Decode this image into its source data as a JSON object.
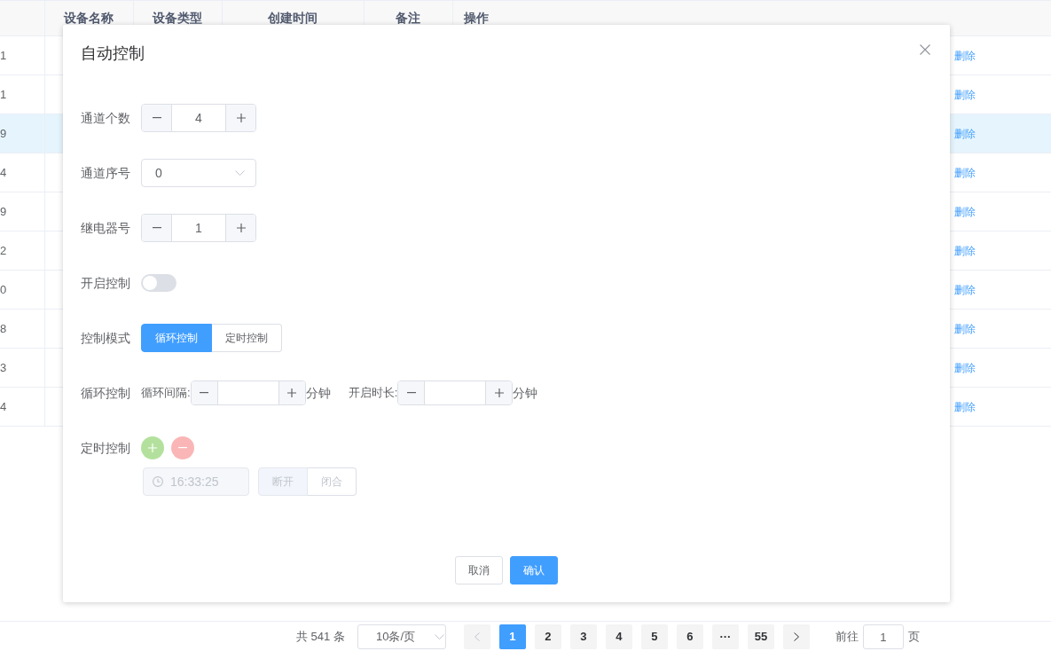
{
  "table": {
    "columns": [
      "设备名称",
      "设备类型",
      "创建时间",
      "备注",
      "操作"
    ],
    "rows": [
      {
        "column_1": "1",
        "selected": false,
        "action": "删除"
      },
      {
        "column_1": "1",
        "selected": false,
        "action": "删除"
      },
      {
        "column_1": "9",
        "selected": true,
        "action": "删除"
      },
      {
        "column_1": "4",
        "selected": false,
        "action": "删除"
      },
      {
        "column_1": "9",
        "selected": false,
        "action": "删除"
      },
      {
        "column_1": "2",
        "selected": false,
        "action": "删除"
      },
      {
        "column_1": "0",
        "selected": false,
        "action": "删除"
      },
      {
        "column_1": "8",
        "selected": false,
        "action": "删除"
      },
      {
        "column_1": "3",
        "selected": false,
        "action": "删除"
      },
      {
        "column_1": "4",
        "selected": false,
        "action": "删除"
      }
    ]
  },
  "dialog": {
    "title": "自动控制",
    "fields": [
      {
        "kind": "number",
        "label": "通道个数",
        "value": "4"
      },
      {
        "kind": "select",
        "label": "通道序号",
        "value": "0"
      },
      {
        "kind": "number",
        "label": "继电器号",
        "value": "1"
      },
      {
        "kind": "switch",
        "label": "开启控制",
        "on": false
      },
      {
        "kind": "radio",
        "label": "控制模式",
        "options": [
          {
            "label": "循环控制",
            "selected": true
          },
          {
            "label": "定时控制",
            "selected": false
          }
        ]
      },
      {
        "kind": "cycle",
        "label": "循环控制",
        "inputs": [
          {
            "label": "循环间隔:",
            "unit": "分钟"
          },
          {
            "label": "开启时长:",
            "unit": "分钟"
          }
        ]
      },
      {
        "kind": "timer",
        "label": "定时控制",
        "entries": [
          {
            "time": "16:33:25",
            "disabled": true,
            "options": [
              {
                "label": "断开",
                "selected": true
              },
              {
                "label": "闭合",
                "selected": false
              }
            ]
          }
        ]
      }
    ],
    "buttons": [
      {
        "label": "取消",
        "primary": false
      },
      {
        "label": "确认",
        "primary": true
      }
    ]
  },
  "pagination": {
    "total": "共 541 条",
    "page_size": "10条/页",
    "pages": [
      {
        "label": "1",
        "selected": true
      },
      {
        "label": "2",
        "selected": false
      },
      {
        "label": "3",
        "selected": false
      },
      {
        "label": "4",
        "selected": false
      },
      {
        "label": "5",
        "selected": false
      },
      {
        "label": "6",
        "selected": false
      },
      {
        "label": "···",
        "selected": false
      },
      {
        "label": "55",
        "selected": false
      }
    ],
    "jump_label": "前往",
    "jump_value": "1",
    "jump_unit": "页"
  }
}
